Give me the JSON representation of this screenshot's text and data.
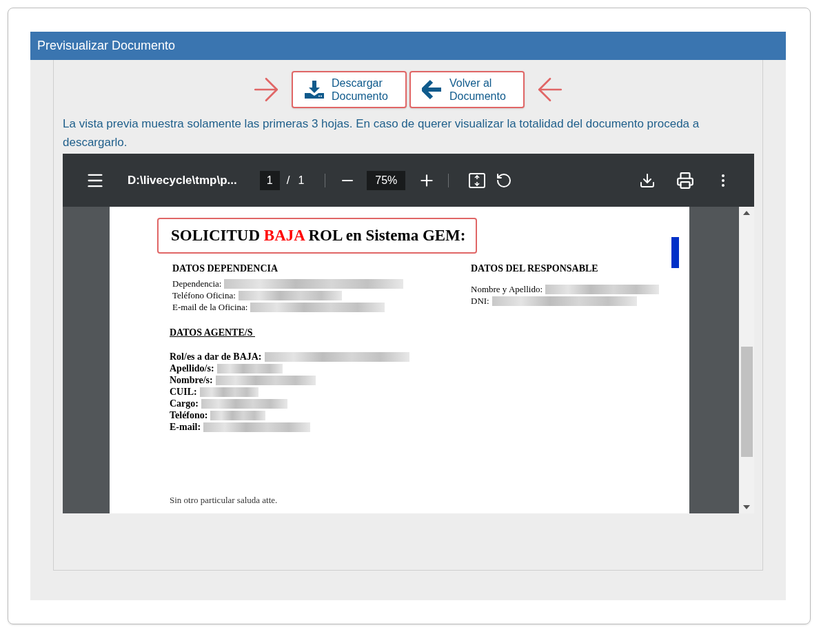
{
  "panel": {
    "title": "Previsualizar Documento"
  },
  "buttons": [
    {
      "kind": "download",
      "line1": "Descargar",
      "line2": "Documento"
    },
    {
      "kind": "back",
      "line1": "Volver al",
      "line2": "Documento"
    }
  ],
  "notice": "La vista previa muestra solamente las primeras 3 hojas. En caso de querer visualizar la totalidad del documento proceda a descargarlo.",
  "viewer": {
    "file_name": "D:\\livecycle\\tmp\\p...",
    "page": "1",
    "page_separator": "/",
    "page_count": "1",
    "zoom": "75%"
  },
  "document": {
    "title": {
      "before": "SOLICITUD ",
      "highlight": "BAJA",
      "after": " ROL en Sistema GEM:"
    },
    "dependencia": {
      "heading": "DATOS DEPENDENCIA",
      "fields": [
        {
          "label": "Dependencia:",
          "redacted": true
        },
        {
          "label": "Teléfono Oficina:",
          "redacted": true
        },
        {
          "label": "E-mail de la Oficina:",
          "redacted": true
        }
      ]
    },
    "responsable": {
      "heading": "DATOS DEL RESPONSABLE",
      "fields": [
        {
          "label": "Nombre y Apellido:",
          "redacted": true
        },
        {
          "label": "DNI:",
          "redacted": true
        }
      ]
    },
    "agentes": {
      "heading": "DATOS AGENTE/S ",
      "fields": [
        {
          "label": "Rol/es a dar de BAJA:",
          "redacted": true
        },
        {
          "label": "Apellido/s:",
          "redacted": true
        },
        {
          "label": "Nombre/s:",
          "redacted": true
        },
        {
          "label": "CUIL:",
          "redacted": true
        },
        {
          "label": "Cargo:",
          "redacted": true
        },
        {
          "label": "Teléfono:",
          "redacted": true
        },
        {
          "label": "E-mail:",
          "redacted": true
        }
      ]
    },
    "closing": "Sin otro particular saluda atte."
  }
}
